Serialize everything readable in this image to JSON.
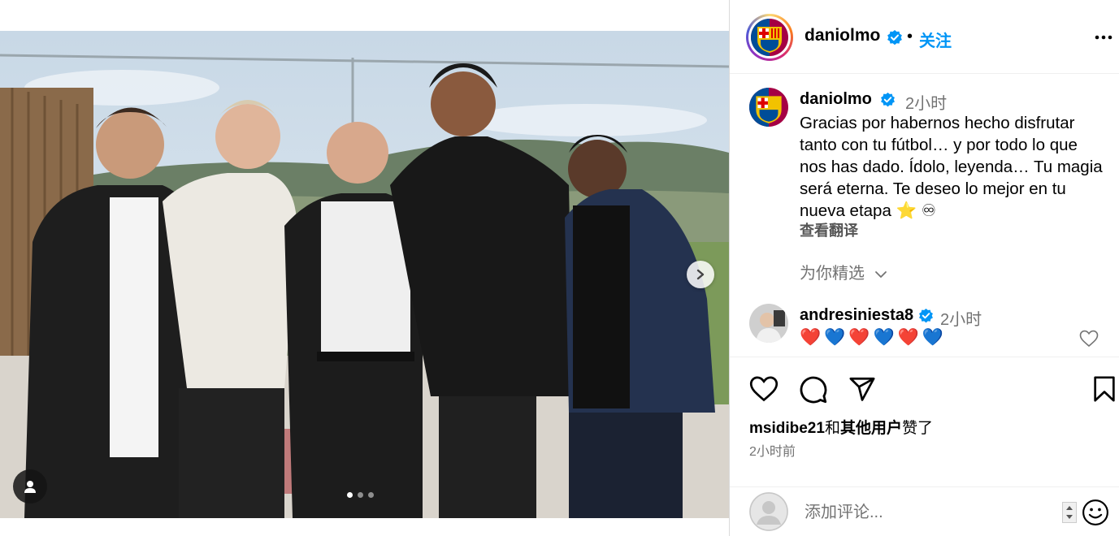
{
  "post": {
    "author": "daniolmo",
    "follow_label": "关注",
    "separator": "•",
    "caption_time": "2小时",
    "caption": "Gracias por habernos hecho disfrutar tanto con tu fútbol… y por todo lo que nos has dado. Ídolo, leyenda… Tu magia será eterna. Te deseo lo mejor en tu nueva etapa ⭐ ♾",
    "translate_label": "查看翻译",
    "for_you_label": "为你精选",
    "carousel_total": 3,
    "carousel_index": 1
  },
  "reply": {
    "author": "andresiniesta8",
    "time": "2小时",
    "hearts": "❤️💙❤️💙❤️💙"
  },
  "likes": {
    "user": "msidibe21",
    "connector": "和",
    "others": "其他用户",
    "suffix": "赞了"
  },
  "posted_time": "2小时前",
  "comment_box": {
    "placeholder": "添加评论..."
  },
  "icons": {
    "next": "chevron-right-icon",
    "tag": "user-tag-icon",
    "more": "more-horizontal-icon",
    "like": "heart-icon",
    "comment": "comment-icon",
    "share": "share-icon",
    "save": "bookmark-icon",
    "emoji": "emoji-icon",
    "verified": "verified-badge-icon"
  },
  "colors": {
    "link_blue": "#0095f6",
    "muted": "#737373",
    "verified": "#0095f6"
  }
}
